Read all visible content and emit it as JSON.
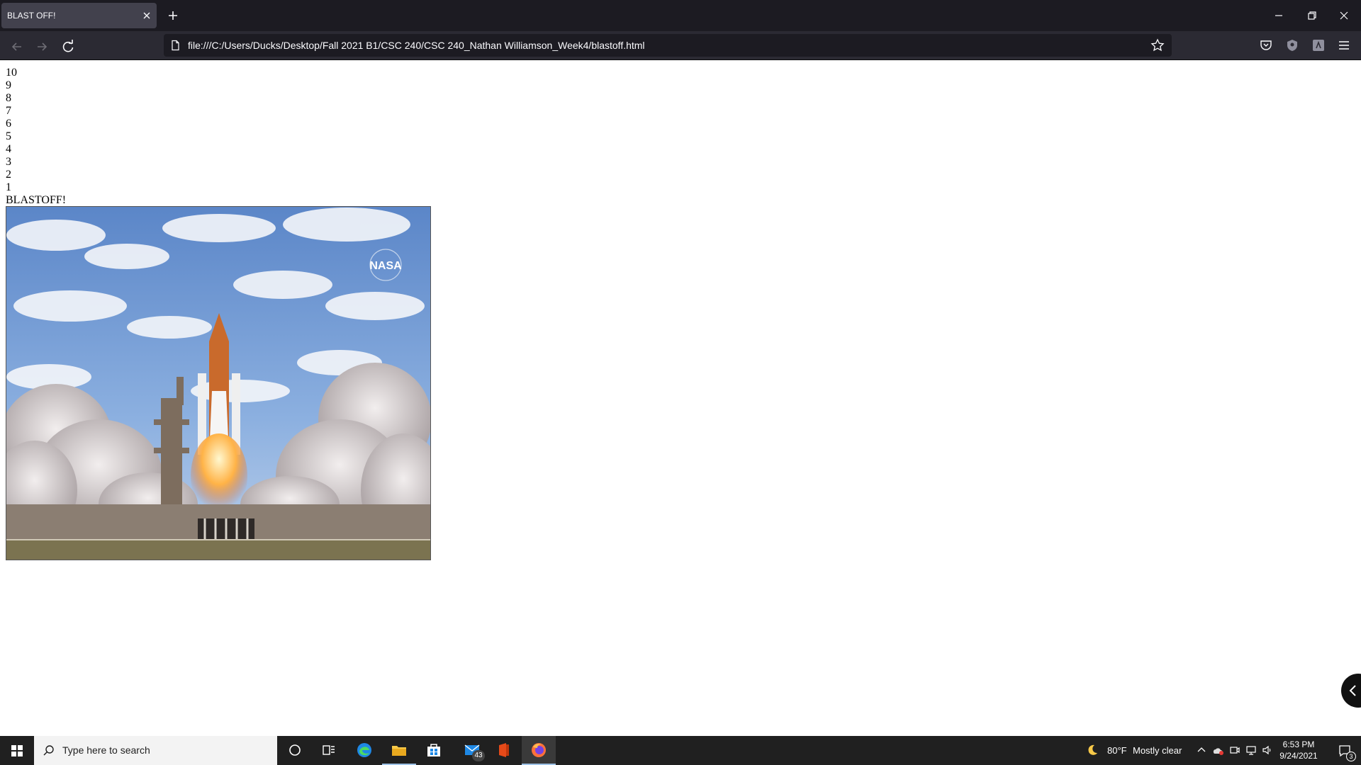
{
  "browser": {
    "tab_title": "BLAST OFF!",
    "url": "file:///C:/Users/Ducks/Desktop/Fall 2021 B1/CSC 240/CSC 240_Nathan Williamson_Week4/blastoff.html"
  },
  "page": {
    "countdown": [
      "10",
      "9",
      "8",
      "7",
      "6",
      "5",
      "4",
      "3",
      "2",
      "1"
    ],
    "final_text": "BLASTOFF!",
    "image_logo_text": "NASA"
  },
  "taskbar": {
    "search_placeholder": "Type here to search",
    "mail_badge": "43",
    "weather_temp": "80°F",
    "weather_desc": "Mostly clear",
    "time": "6:53 PM",
    "date": "9/24/2021",
    "notifications_count": "3"
  },
  "colors": {
    "tabbar": "#1c1b22",
    "navbar": "#2b2a33",
    "taskbar": "#202020"
  }
}
